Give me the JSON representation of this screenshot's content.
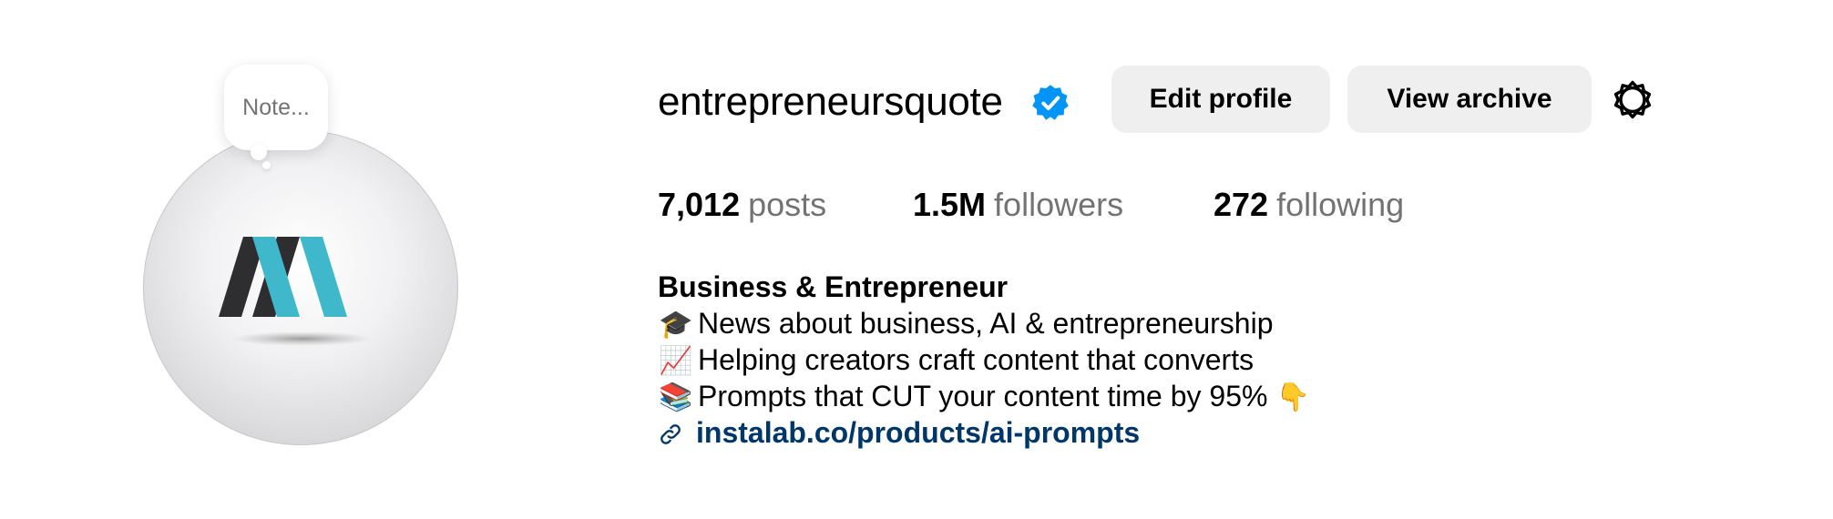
{
  "note": {
    "placeholder": "Note..."
  },
  "avatar": {
    "alt": "entrepreneursquote profile picture",
    "colors": {
      "teal": "#3fb8cc",
      "dark": "#2e2e30"
    }
  },
  "header": {
    "username": "entrepreneursquote",
    "verified_icon": "verified-badge-icon",
    "edit_profile_label": "Edit profile",
    "view_archive_label": "View archive",
    "settings_icon": "gear-icon"
  },
  "stats": {
    "posts": {
      "value": "7,012",
      "label": "posts"
    },
    "followers": {
      "value": "1.5M",
      "label": "followers"
    },
    "following": {
      "value": "272",
      "label": "following"
    }
  },
  "bio": {
    "name": "Business & Entrepreneur",
    "lines": [
      {
        "emoji": "🎓",
        "text": "News about business, AI & entrepreneurship",
        "trailing": ""
      },
      {
        "emoji": "📈",
        "text": "Helping creators craft content that converts",
        "trailing": ""
      },
      {
        "emoji": "📚",
        "text": "Prompts that CUT your content time by 95%",
        "trailing": "👇"
      }
    ],
    "link_icon": "link-icon",
    "link": "instalab.co/products/ai-prompts"
  },
  "colors": {
    "link": "#00376b",
    "secondary_text": "#737373",
    "button_bg": "#efefef",
    "verified": "#0095f6"
  }
}
